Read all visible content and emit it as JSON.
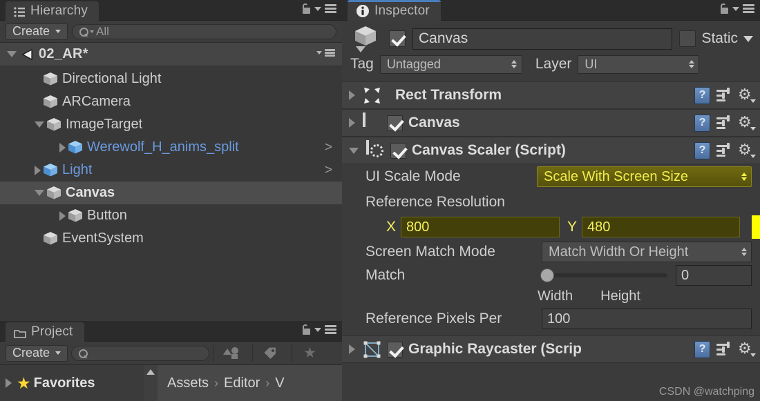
{
  "hierarchy": {
    "tab_label": "Hierarchy",
    "tab_icon": "hierarchy-icon",
    "create_label": "Create",
    "search_value": "All",
    "scene_name": "02_AR*",
    "nodes": [
      {
        "label": "Directional Light",
        "indent": 1,
        "twisty": "none",
        "cube": "grey",
        "style": "normal",
        "arrow": "",
        "selected": false
      },
      {
        "label": "ARCamera",
        "indent": 1,
        "twisty": "none",
        "cube": "grey",
        "style": "normal",
        "arrow": "",
        "selected": false
      },
      {
        "label": "ImageTarget",
        "indent": 1,
        "twisty": "open",
        "cube": "grey",
        "style": "normal",
        "arrow": "",
        "selected": false
      },
      {
        "label": "Werewolf_H_anims_split",
        "indent": 2,
        "twisty": "closed",
        "cube": "blue",
        "style": "prefab",
        "arrow": ">",
        "selected": false
      },
      {
        "label": "Light",
        "indent": 1,
        "twisty": "closed",
        "cube": "blue",
        "style": "prefab",
        "arrow": ">",
        "selected": false
      },
      {
        "label": "Canvas",
        "indent": 1,
        "twisty": "open",
        "cube": "grey",
        "style": "bold",
        "arrow": "",
        "selected": true
      },
      {
        "label": "Button",
        "indent": 2,
        "twisty": "closed",
        "cube": "grey",
        "style": "normal",
        "arrow": "",
        "selected": false
      },
      {
        "label": "EventSystem",
        "indent": 1,
        "twisty": "none",
        "cube": "grey",
        "style": "normal",
        "arrow": "",
        "selected": false
      }
    ]
  },
  "project": {
    "tab_label": "Project",
    "tab_icon": "folder-icon",
    "create_label": "Create",
    "search_value": "",
    "favorites_label": "Favorites",
    "breadcrumb": [
      "Assets",
      "Editor",
      "V"
    ],
    "breadcrumb_separator": "›"
  },
  "inspector": {
    "tab_label": "Inspector",
    "tab_icon": "info-icon",
    "object_name": "Canvas",
    "object_enabled": true,
    "static_label": "Static",
    "static_checked": false,
    "tag_label": "Tag",
    "tag_value": "Untagged",
    "layer_label": "Layer",
    "layer_value": "UI",
    "components": [
      {
        "title": "Rect Transform",
        "icon": "rect-transform-icon",
        "expanded": false,
        "has_toggle": false,
        "enabled": false
      },
      {
        "title": "Canvas",
        "icon": "canvas-icon",
        "expanded": false,
        "has_toggle": true,
        "enabled": true
      },
      {
        "title": "Canvas Scaler (Script)",
        "icon": "canvas-scaler-icon",
        "expanded": true,
        "has_toggle": true,
        "enabled": true
      },
      {
        "title": "Graphic Raycaster (Scrip",
        "icon": "graphic-raycaster-icon",
        "expanded": false,
        "has_toggle": true,
        "enabled": true
      }
    ],
    "canvas_scaler": {
      "ui_scale_mode_label": "UI Scale Mode",
      "ui_scale_mode_value": "Scale With Screen Size",
      "reference_resolution_label": "Reference Resolution",
      "ref_x_label": "X",
      "ref_x_value": "800",
      "ref_y_label": "Y",
      "ref_y_value": "480",
      "screen_match_mode_label": "Screen Match Mode",
      "screen_match_mode_value": "Match Width Or Height",
      "match_label": "Match",
      "match_value": "0",
      "match_min_label": "Width",
      "match_max_label": "Height",
      "match_slider_percent": 0,
      "reference_pixels_label": "Reference Pixels Per",
      "reference_pixels_value": "100"
    }
  },
  "watermark": "CSDN @watchping",
  "colors": {
    "accent_blue": "#4a7ebb",
    "prefab_blue": "#6a9ae0",
    "highlight_yellow": "#f3ef5d",
    "edge_yellow": "#ffff00",
    "favorite_star": "#ffd633"
  }
}
